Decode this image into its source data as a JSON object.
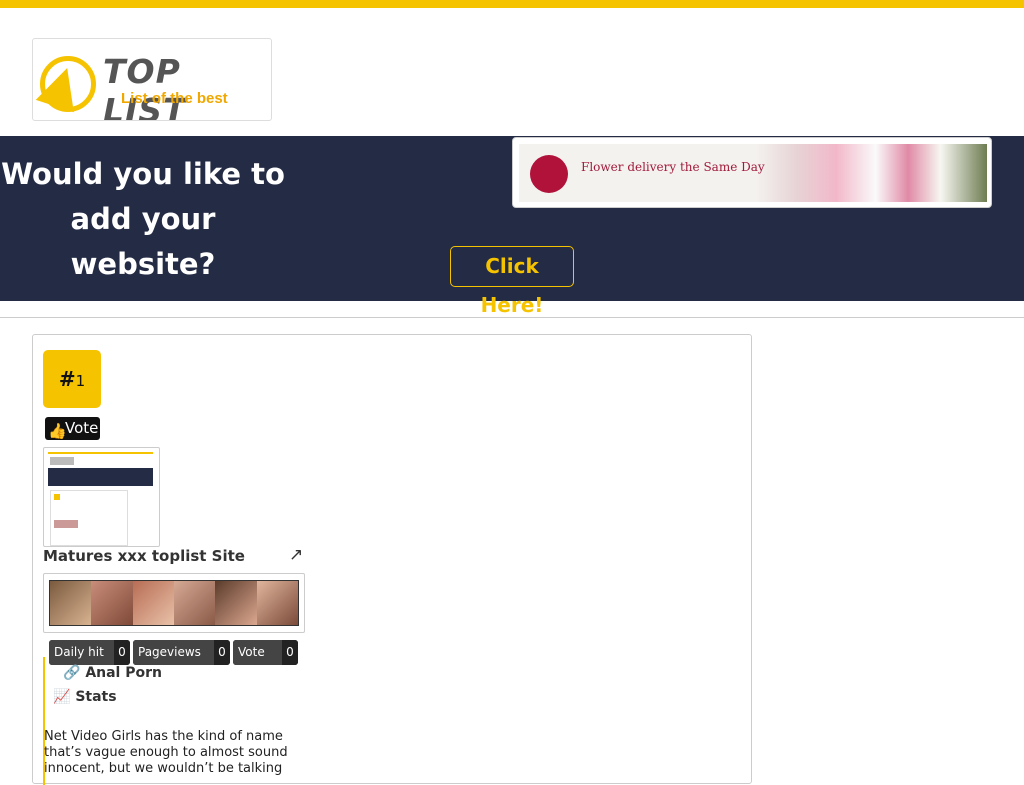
{
  "colors": {
    "accent": "#f5c300",
    "banner_bg": "#242b44",
    "ad_dot": "#b0123a"
  },
  "logo": {
    "title": "TOP LIST",
    "subtitle": "List of the best"
  },
  "banner": {
    "question_line1": "Would you like to",
    "question_line2": "add your website?",
    "cta_label": "Click Here!",
    "ad_text": "Flower delivery the Same Day"
  },
  "listing": {
    "rank_symbol": "#",
    "rank_number": "1",
    "vote_label": "Vote",
    "vote_icon": "thumbs-up-icon",
    "site_title": "Matures xxx toplist Site",
    "external_icon": "external-link-icon",
    "stats": [
      {
        "label": "Daily hit",
        "value": "0"
      },
      {
        "label": "Pageviews",
        "value": "0"
      },
      {
        "label": "Vote",
        "value": "0"
      }
    ],
    "link_icon": "link-icon",
    "link_label": "Anal Porn",
    "stats_icon": "line-chart-icon",
    "stats_label": "Stats",
    "description": "Net Video Girls has the kind of name that’s vague enough to almost sound innocent, but we wouldn’t be talking"
  }
}
